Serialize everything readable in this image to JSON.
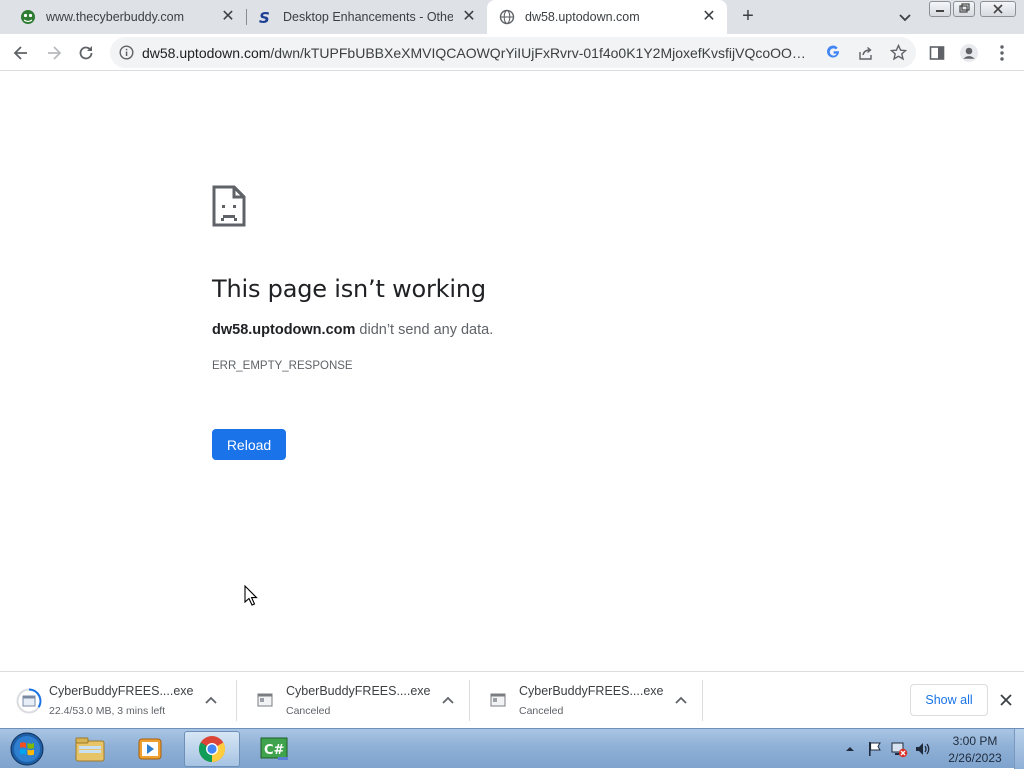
{
  "browser": {
    "tabs": [
      {
        "title": "www.thecyberbuddy.com",
        "icon": "cyberbuddy-favicon",
        "active": false
      },
      {
        "title": "Desktop Enhancements - Other Sof",
        "icon": "softpedia-favicon",
        "active": false
      },
      {
        "title": "dw58.uptodown.com",
        "icon": "globe-icon",
        "active": true
      }
    ],
    "address_bar": {
      "host": "dw58.uptodown.com",
      "path": "/dwn/kTUPFbUBBXeXMVIQCAOWQrYiIUjFxRvrv-01f4o0K1Y2MjoxefKvsfijVQcoOOcOT..."
    }
  },
  "error_page": {
    "title": "This page isn’t working",
    "host": "dw58.uptodown.com",
    "message": " didn’t send any data.",
    "code": "ERR_EMPTY_RESPONSE",
    "reload_label": "Reload"
  },
  "downloads": {
    "items": [
      {
        "name": "CyberBuddyFREES....exe",
        "status": "22.4/53.0 MB, 3 mins left"
      },
      {
        "name": "CyberBuddyFREES....exe",
        "status": "Canceled"
      },
      {
        "name": "CyberBuddyFREES....exe",
        "status": "Canceled"
      }
    ],
    "show_all_label": "Show all"
  },
  "taskbar": {
    "apps": [
      "windows-explorer",
      "media-player",
      "google-chrome",
      "csharp-ide"
    ],
    "clock_time": "3:00 PM",
    "clock_date": "2/26/2023"
  },
  "colors": {
    "accent": "#1a73e8",
    "tabstrip": "#dee1e6",
    "text_primary": "#202124",
    "text_secondary": "#5f6368"
  }
}
